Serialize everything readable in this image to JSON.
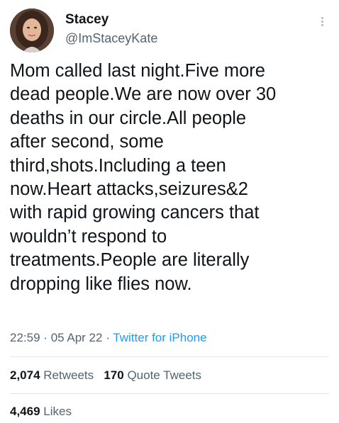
{
  "author": {
    "display_name": "Stacey",
    "handle": "@ImStaceyKate"
  },
  "tweet": {
    "lines": [
      "Mom called last night.Five more",
      "dead people.We are now over 30",
      "deaths in our circle.All people",
      "after second, some",
      "third,shots.Including a teen",
      "now.Heart attacks,seizures&2",
      "with rapid growing cancers that",
      "wouldn’t respond to",
      "treatments.People are literally",
      "dropping like flies now."
    ],
    "time": "22:59",
    "date": "05 Apr 22",
    "source": "Twitter for iPhone",
    "dot": "·"
  },
  "stats": {
    "retweets_count": "2,074",
    "retweets_label": "Retweets",
    "quotes_count": "170",
    "quotes_label": "Quote Tweets",
    "likes_count": "4,469",
    "likes_label": "Likes"
  },
  "icons": {
    "more": "more-options-icon",
    "avatar": "profile-avatar"
  },
  "colors": {
    "text": "#0f1419",
    "secondary": "#536471",
    "link": "#1d9bf0",
    "divider": "#e1e8ed"
  }
}
